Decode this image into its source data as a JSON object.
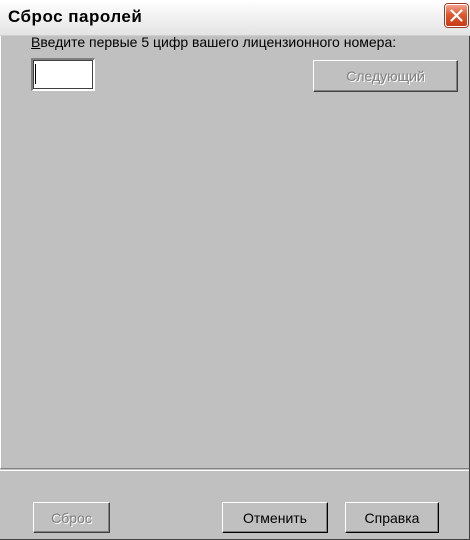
{
  "window": {
    "title": "Сброс паролей",
    "close_icon": "close-icon"
  },
  "prompt": {
    "accel": "В",
    "rest": "ведите первые 5 цифр вашего лицензионного номера:"
  },
  "license_input": {
    "value": "",
    "placeholder": ""
  },
  "buttons": {
    "next": "Следующий",
    "reset": "Сброс",
    "cancel": "Отменить",
    "help": "Справка"
  },
  "colors": {
    "face": "#c0c0c0",
    "disabled_text": "#808080",
    "close_red": "#e0582f"
  }
}
